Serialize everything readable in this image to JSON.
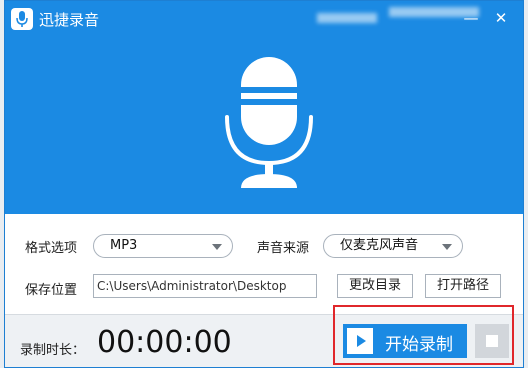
{
  "app": {
    "title": "迅捷录音"
  },
  "window_controls": {
    "minimize": "—",
    "close": "✕"
  },
  "settings": {
    "format_label": "格式选项",
    "format_value": "MP3",
    "source_label": "声音来源",
    "source_value": "仅麦克风声音",
    "save_label": "保存位置",
    "save_path": "C:\\Users\\Administrator\\Desktop",
    "change_dir_button": "更改目录",
    "open_path_button": "打开路径"
  },
  "footer": {
    "duration_label": "录制时长：",
    "timer": "00:00:00",
    "start_button": "开始录制"
  },
  "colors": {
    "accent": "#1b8ae3",
    "highlight": "#e0272b"
  },
  "icons": {
    "logo": "microphone-icon",
    "mic": "microphone-icon",
    "play": "play-icon",
    "stop": "stop-icon"
  }
}
